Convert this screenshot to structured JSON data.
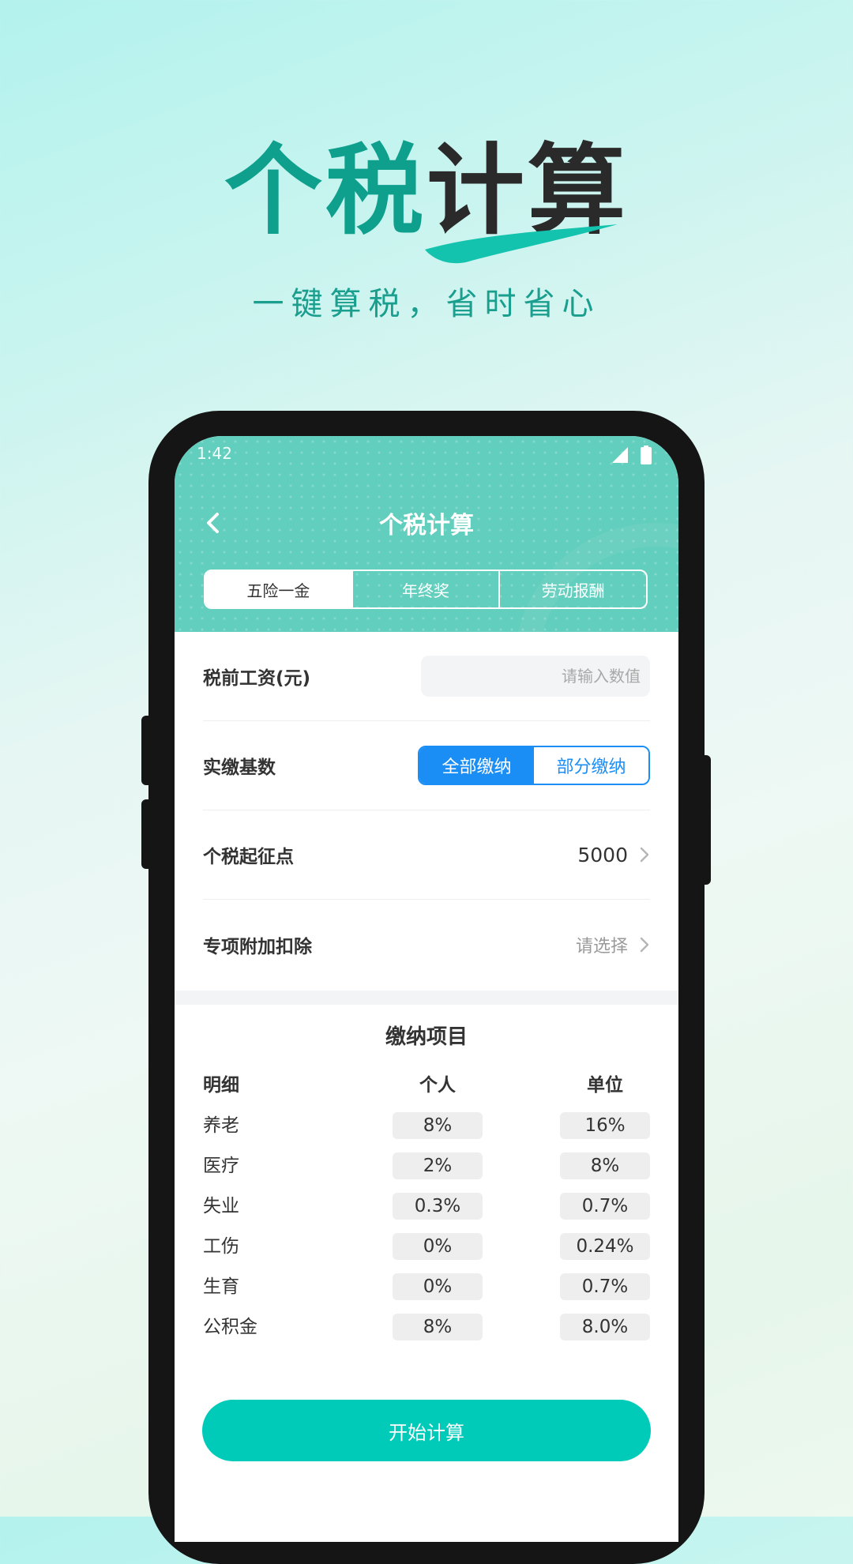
{
  "promo": {
    "title_accent": "个税",
    "title_dark": "计算",
    "subtitle": "一键算税，省时省心"
  },
  "status_bar": {
    "time": "1:42"
  },
  "header": {
    "title": "个税计算",
    "tabs": [
      {
        "label": "五险一金",
        "active": true
      },
      {
        "label": "年终奖",
        "active": false
      },
      {
        "label": "劳动报酬",
        "active": false
      }
    ]
  },
  "form": {
    "salary_label": "税前工资(元)",
    "salary_placeholder": "请输入数值",
    "salary_value": "",
    "base_label": "实缴基数",
    "base_options": [
      "全部缴纳",
      "部分缴纳"
    ],
    "base_selected": "全部缴纳",
    "threshold_label": "个税起征点",
    "threshold_value": "5000",
    "deduction_label": "专项附加扣除",
    "deduction_value": "请选择"
  },
  "contributions": {
    "title": "缴纳项目",
    "headers": [
      "明细",
      "个人",
      "单位"
    ],
    "rows": [
      {
        "name": "养老",
        "personal": "8%",
        "unit": "16%"
      },
      {
        "name": "医疗",
        "personal": "2%",
        "unit": "8%"
      },
      {
        "name": "失业",
        "personal": "0.3%",
        "unit": "0.7%"
      },
      {
        "name": "工伤",
        "personal": "0%",
        "unit": "0.24%"
      },
      {
        "name": "生育",
        "personal": "0%",
        "unit": "0.7%"
      },
      {
        "name": "公积金",
        "personal": "8%",
        "unit": "8.0%"
      }
    ]
  },
  "actions": {
    "calculate_label": "开始计算"
  },
  "colors": {
    "brand_teal": "#62cebd",
    "button_teal": "#00cbb9",
    "toggle_blue": "#1a8ef5",
    "title_green": "#0f9f8d"
  },
  "icons": [
    "back-arrow-icon",
    "signal-icon",
    "battery-icon",
    "chevron-right-icon"
  ]
}
